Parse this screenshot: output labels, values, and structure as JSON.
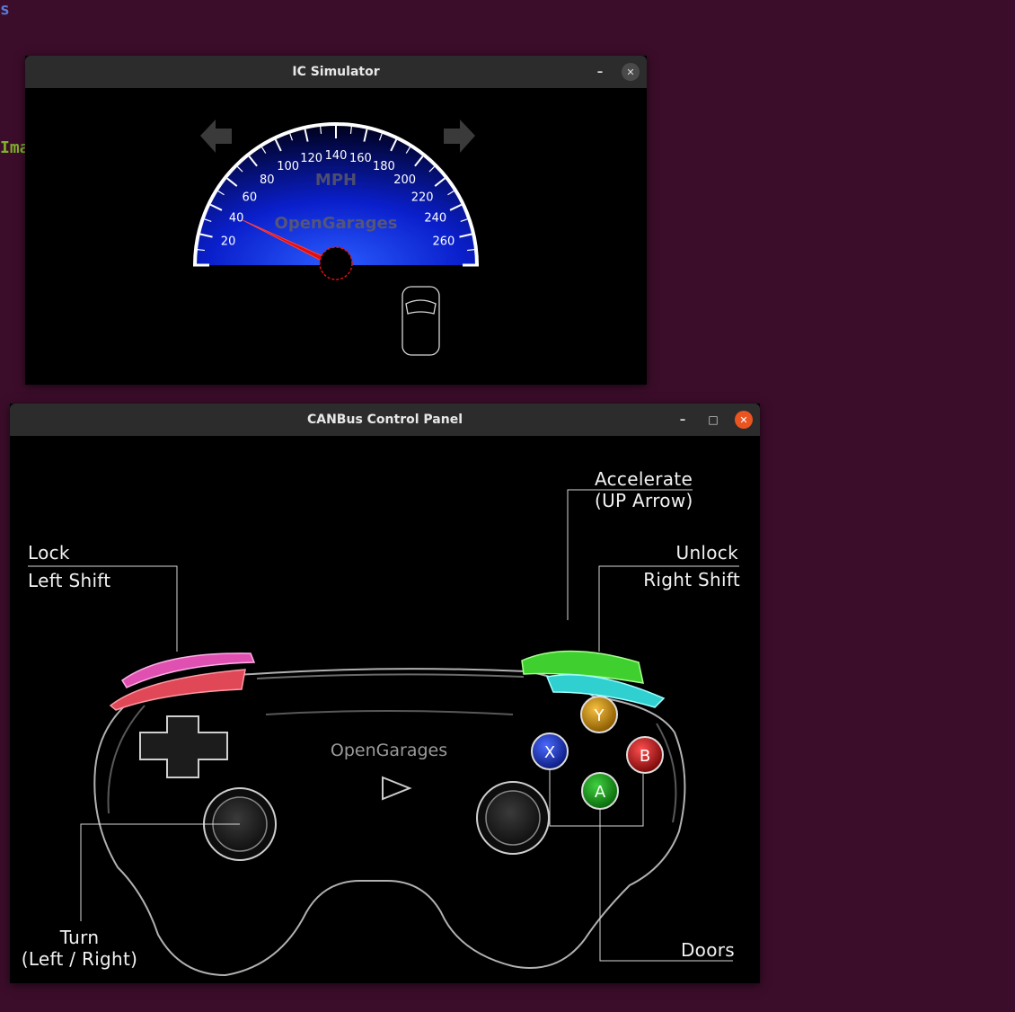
{
  "background": {
    "fragment_top": "s",
    "fragment_left": "Ima",
    "desktop_color": "#3b0d2a"
  },
  "ic_window": {
    "title": "IC Simulator",
    "minimize_label": "–",
    "close_label": "✕"
  },
  "speedometer": {
    "unit": "MPH",
    "brand": "OpenGarages",
    "ticks": [
      "20",
      "40",
      "60",
      "80",
      "100",
      "120",
      "140",
      "160",
      "180",
      "200",
      "220",
      "240",
      "260"
    ],
    "speed_value": 40,
    "max_value": 280,
    "left_signal_on": false,
    "right_signal_on": false,
    "doors": "closed"
  },
  "control_window": {
    "title": "CANBus Control Panel",
    "minimize_label": "–",
    "maximize_label": "□",
    "close_label": "✕"
  },
  "controller": {
    "brand": "OpenGarages",
    "buttons": {
      "y": "Y",
      "x": "X",
      "b": "B",
      "a": "A"
    },
    "labels": {
      "accelerate_1": "Accelerate",
      "accelerate_2": "(UP Arrow)",
      "lock_1": "Lock",
      "lock_2": "Left Shift",
      "unlock_1": "Unlock",
      "unlock_2": "Right Shift",
      "turn_1": "Turn",
      "turn_2": "(Left / Right)",
      "doors": "Doors"
    }
  }
}
